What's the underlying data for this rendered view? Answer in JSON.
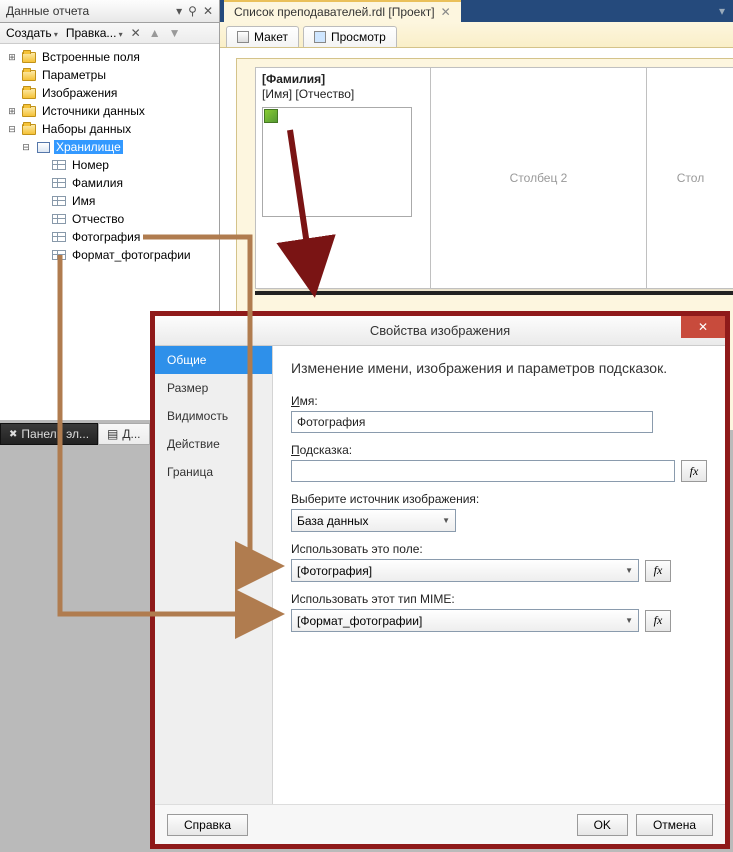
{
  "panel": {
    "title": "Данные отчета",
    "create": "Создать",
    "edit": "Правка...",
    "tree": {
      "builtin": "Встроенные поля",
      "params": "Параметры",
      "images": "Изображения",
      "sources": "Источники данных",
      "datasets": "Наборы данных",
      "dataset_name": "Хранилище",
      "fields": [
        "Номер",
        "Фамилия",
        "Имя",
        "Отчество",
        "Фотография",
        "Формат_фотографии"
      ]
    }
  },
  "bottom_tabs": {
    "panel": "Панель эл...",
    "d": "Д..."
  },
  "doc_tab": "Список преподавателей.rdl [Проект]",
  "view_tabs": {
    "layout": "Макет",
    "preview": "Просмотр"
  },
  "report": {
    "header_field": "[Фамилия]",
    "sub_fields": "[Имя] [Отчество]",
    "col2": "Столбец 2",
    "col3": "Стол"
  },
  "dialog": {
    "title": "Свойства изображения",
    "nav": [
      "Общие",
      "Размер",
      "Видимость",
      "Действие",
      "Граница"
    ],
    "heading": "Изменение имени, изображения и параметров подсказок.",
    "name_label": "Имя:",
    "name_value": "Фотография",
    "tooltip_label": "Подсказка:",
    "tooltip_value": "",
    "source_label": "Выберите источник изображения:",
    "source_value": "База данных",
    "field_label": "Использовать это поле:",
    "field_value": "[Фотография]",
    "mime_label": "Использовать этот тип MIME:",
    "mime_value": "[Формат_фотографии]",
    "help": "Справка",
    "ok": "OK",
    "cancel": "Отмена",
    "fx": "fx"
  }
}
